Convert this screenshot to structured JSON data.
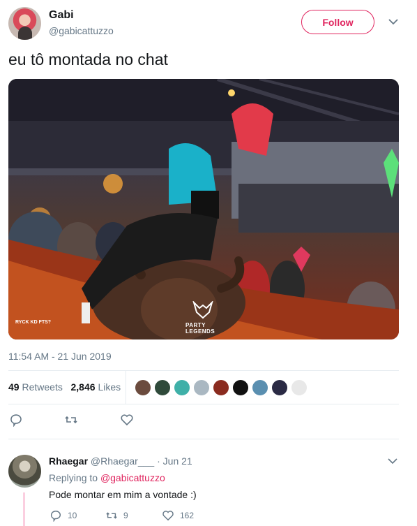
{
  "tweet": {
    "author_name": "Gabi",
    "author_handle": "@gabicattuzzo",
    "follow_label": "Follow",
    "text": "eu tô montada no chat",
    "photo_texts": {
      "left_logo": "RYCK KD FTS?",
      "right_logo_top": "PARTY",
      "right_logo_bottom": "LEGENDS"
    },
    "timestamp": "11:54 AM - 21 Jun 2019",
    "retweets_count": "49",
    "retweets_label": "Retweets",
    "likes_count": "2,846",
    "likes_label": "Likes"
  },
  "likers": [
    {
      "color": "#6b4b3e",
      "icon": "avatar"
    },
    {
      "color": "#2f4a3a",
      "icon": "avatar"
    },
    {
      "color": "#3fb0a8",
      "icon": "perry-avatar"
    },
    {
      "color": "#aab8c2",
      "icon": "default-avatar"
    },
    {
      "color": "#8a2b1f",
      "icon": "avatar"
    },
    {
      "color": "#111111",
      "icon": "avatar"
    },
    {
      "color": "#5a8fb0",
      "icon": "avatar"
    },
    {
      "color": "#2a2a44",
      "icon": "avatar"
    },
    {
      "color": "#e8e8e8",
      "icon": "avatar"
    }
  ],
  "reply": {
    "author_name": "Rhaegar",
    "author_handle": "@Rhaegar___",
    "separator": "·",
    "date": "Jun 21",
    "replying_prefix": "Replying to",
    "replying_to": "@gabicattuzzo",
    "text": "Pode montar em mim a vontade :)",
    "replies_count": "10",
    "retweets_count": "9",
    "likes_count": "162"
  },
  "colors": {
    "accent": "#e0245e",
    "secondary_text": "#657786",
    "divider": "#e6ecf0"
  }
}
